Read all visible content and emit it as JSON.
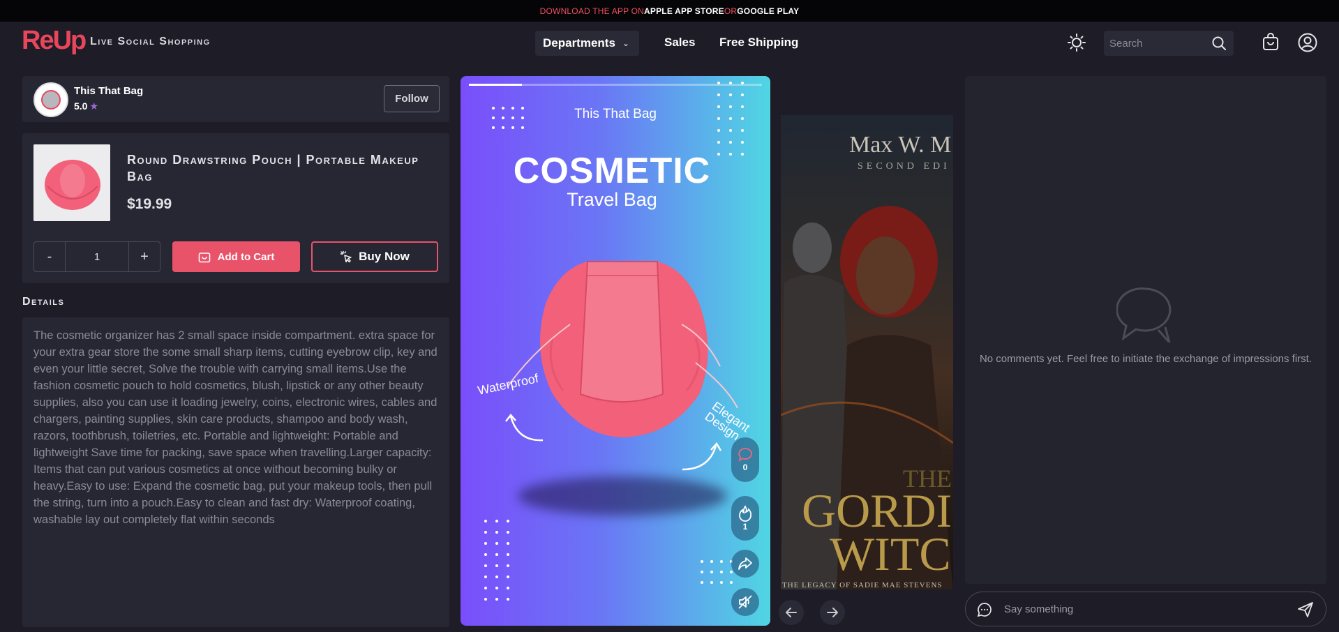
{
  "promo": {
    "part1": "DOWNLOAD THE APP ON ",
    "part2": "APPLE APP STORE",
    "part3": " OR ",
    "part4": "GOOGLE PLAY"
  },
  "header": {
    "logo": "ReUp",
    "tagline": "Live Social Shopping",
    "departments": "Departments",
    "nav": [
      "Sales",
      "Free Shipping"
    ],
    "search_placeholder": "Search"
  },
  "seller": {
    "name": "This That Bag",
    "rating": "5.0",
    "rating_icon": "star-icon",
    "follow": "Follow"
  },
  "product": {
    "title": "Round Drawstring Pouch | Portable Makeup Bag",
    "price": "$19.99",
    "quantity": "1",
    "minus": "-",
    "plus": "+",
    "add_to_cart": "Add to Cart",
    "buy_now": "Buy Now"
  },
  "details": {
    "heading": "Details",
    "text": "The cosmetic organizer has 2 small space inside compartment. extra space for your extra gear store the some small sharp items, cutting eyebrow clip, key and even your little secret, Solve the trouble with carrying small items.Use the fashion cosmetic pouch to hold cosmetics, blush, lipstick or any other beauty supplies, also you can use it loading jewelry, coins, electronic wires, cables and chargers, painting supplies, skin care products, shampoo and body wash, razors, toothbrush, toiletries, etc. Portable and lightweight: Portable and lightweight Save time for packing, save space when travelling.Larger capacity: Items that can put various cosmetics at once without becoming bulky or heavy.Easy to use: Expand the cosmetic bag, put your makeup tools, then pull the string, turn into a pouch.Easy to clean and fast dry: Waterproof coating, washable lay out completely flat within seconds"
  },
  "video": {
    "brand": "This That Bag",
    "title": "COSMETIC",
    "subtitle": "Travel Bag",
    "label_left": "Waterproof",
    "label_right_1": "Elegant",
    "label_right_2": "Design",
    "comments_count": "0",
    "likes_count": "1",
    "progress": 0.18,
    "bag_color": "#f2607a"
  },
  "next_video": {
    "author": "Max W. M",
    "edition": "SECOND EDI",
    "title_1": "THE",
    "title_2": "GORDI",
    "title_3": "WITC",
    "series": "THE LEGACY OF SADIE MAE STEVENS"
  },
  "comments": {
    "empty": "No comments yet. Feel free to initiate the exchange of impressions first.",
    "placeholder": "Say something"
  },
  "colors": {
    "accent": "#e8536a",
    "background": "#1d1c27",
    "panel": "#272734"
  }
}
